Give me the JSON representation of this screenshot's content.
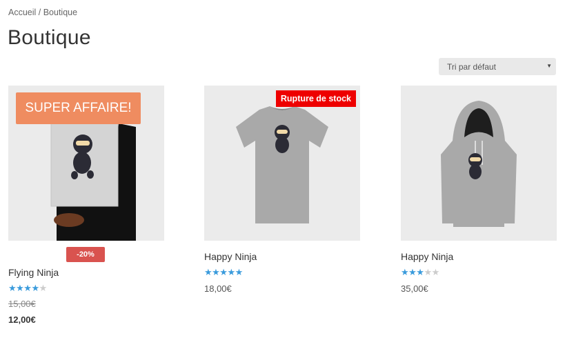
{
  "breadcrumb": {
    "home": "Accueil",
    "sep": " / ",
    "current": "Boutique"
  },
  "page_title": "Boutique",
  "sort": {
    "selected": "Tri par défaut"
  },
  "products": [
    {
      "badge": "SUPER AFFAIRE!",
      "sale": "-20%",
      "name": "Flying Ninja",
      "rating": 4,
      "old_price": "15,00€",
      "price": "12,00€",
      "image": "ninja poster"
    },
    {
      "badge": "Rupture de stock",
      "name": "Happy Ninja",
      "rating": 5,
      "price": "18,00€",
      "image": "ninja t-shirt"
    },
    {
      "name": "Happy Ninja",
      "rating": 3,
      "price": "35,00€",
      "image": "ninja hoodie"
    }
  ]
}
